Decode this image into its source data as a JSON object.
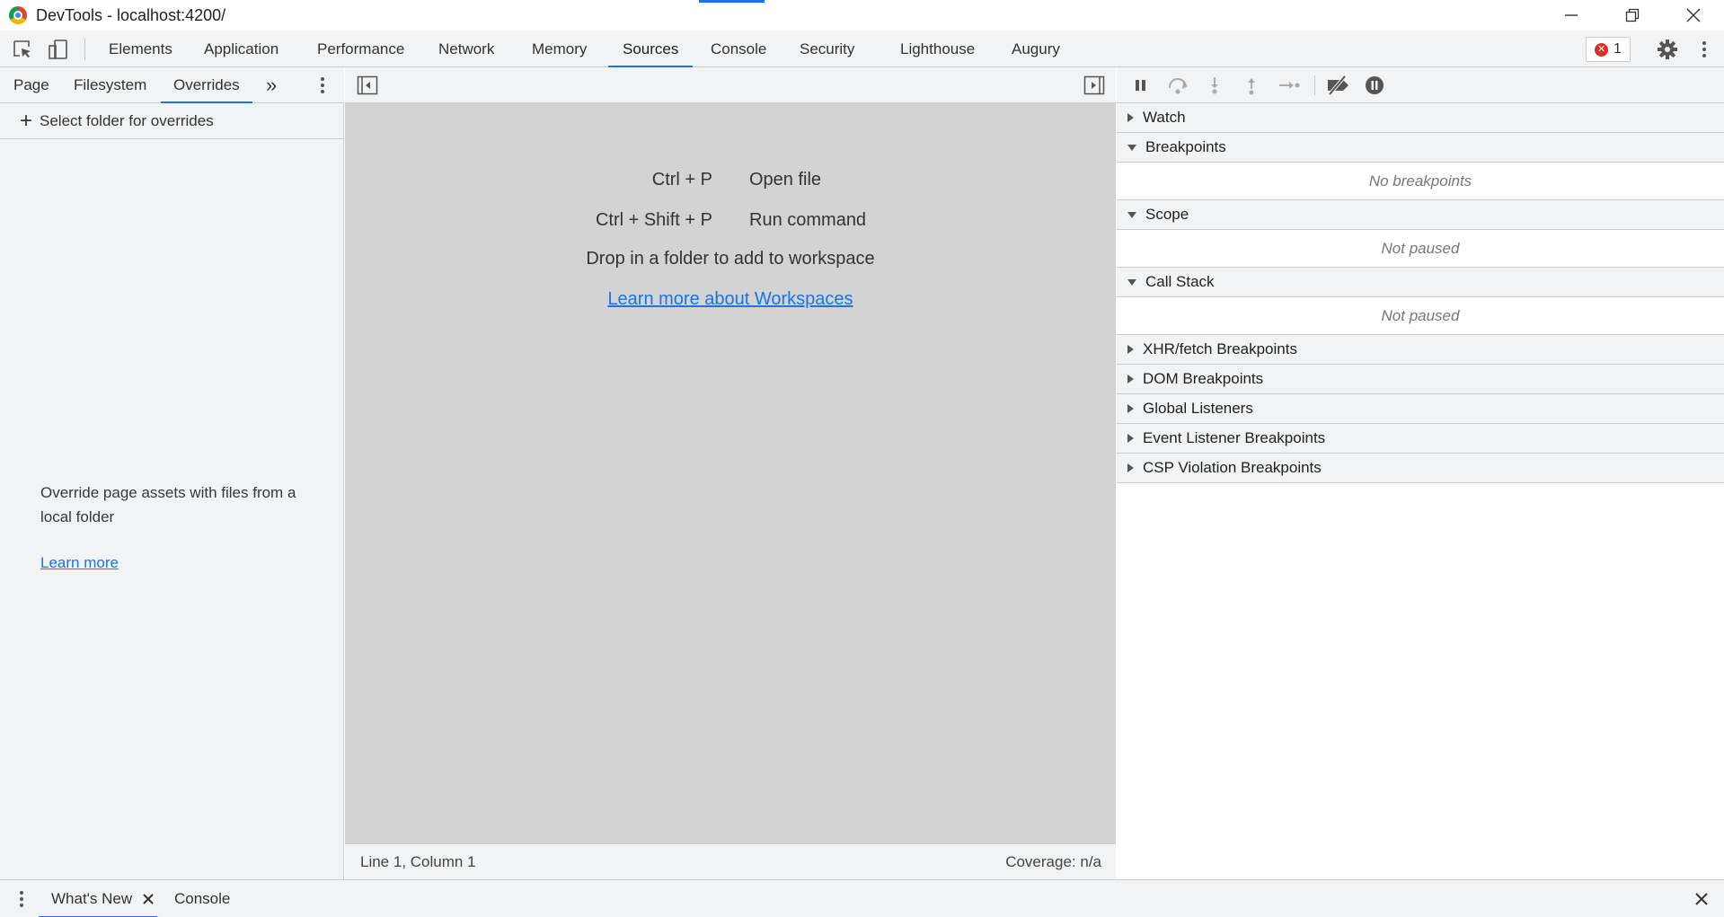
{
  "window": {
    "title": "DevTools - localhost:4200/"
  },
  "main_tabs": [
    "Elements",
    "Application",
    "Performance",
    "Network",
    "Memory",
    "Sources",
    "Console",
    "Security",
    "Lighthouse",
    "Augury"
  ],
  "active_main_tab": "Sources",
  "error_count": "1",
  "navigator": {
    "tabs": [
      "Page",
      "Filesystem",
      "Overrides"
    ],
    "active_tab": "Overrides",
    "more_tabs_icon": "double-chevron-right-icon",
    "select_folder": "Select folder for overrides",
    "message": "Override page assets with files from a local folder",
    "learn_more": "Learn more"
  },
  "editor": {
    "shortcuts": [
      {
        "keys": "Ctrl + P",
        "action": "Open file"
      },
      {
        "keys": "Ctrl + Shift + P",
        "action": "Run command"
      }
    ],
    "drop_message": "Drop in a folder to add to workspace",
    "workspace_link": "Learn more about Workspaces",
    "status_position": "Line 1, Column 1",
    "status_coverage": "Coverage: n/a"
  },
  "debugger": {
    "sections": [
      {
        "label": "Watch",
        "expanded": false
      },
      {
        "label": "Breakpoints",
        "expanded": true,
        "body": "No breakpoints"
      },
      {
        "label": "Scope",
        "expanded": true,
        "body": "Not paused"
      },
      {
        "label": "Call Stack",
        "expanded": true,
        "body": "Not paused"
      },
      {
        "label": "XHR/fetch Breakpoints",
        "expanded": false
      },
      {
        "label": "DOM Breakpoints",
        "expanded": false
      },
      {
        "label": "Global Listeners",
        "expanded": false
      },
      {
        "label": "Event Listener Breakpoints",
        "expanded": false
      },
      {
        "label": "CSP Violation Breakpoints",
        "expanded": false
      }
    ]
  },
  "drawer": {
    "tabs": [
      "What's New",
      "Console"
    ],
    "active_tab": "What's New"
  },
  "colors": {
    "accent": "#1a73e8",
    "error": "#d93025",
    "editor_bg": "#d3d3d3",
    "toolbar_bg": "#f1f3f4"
  }
}
